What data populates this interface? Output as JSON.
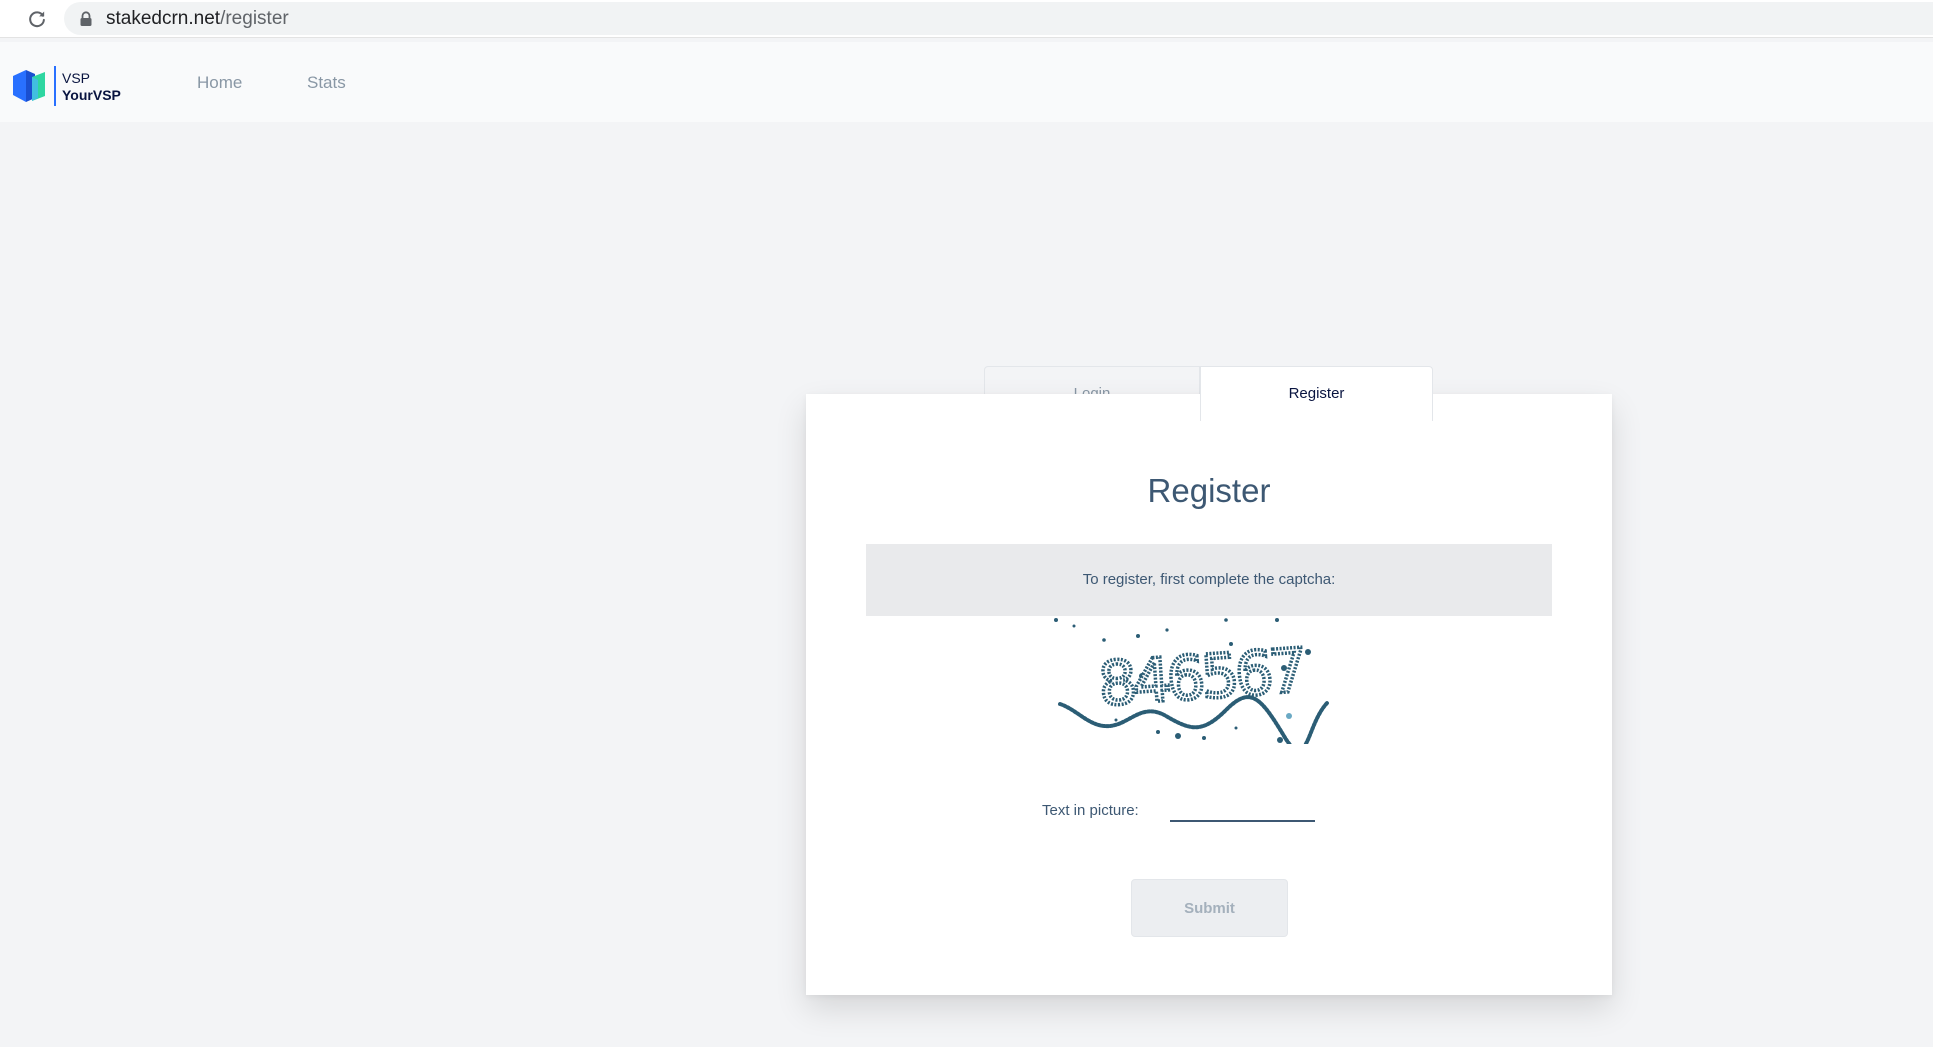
{
  "browser": {
    "url_host": "stakedcrn.net",
    "url_path": "/register"
  },
  "header": {
    "logo_line1": "VSP",
    "logo_line2": "YourVSP",
    "nav": [
      {
        "label": "Home"
      },
      {
        "label": "Stats"
      }
    ]
  },
  "tabs": [
    {
      "label": "Login",
      "active": false
    },
    {
      "label": "Register",
      "active": true
    }
  ],
  "register": {
    "title": "Register",
    "info_text": "To register, first complete the captcha:",
    "captcha_text": "846567",
    "captcha_label": "Text in picture:",
    "captcha_input_value": "",
    "submit_label": "Submit"
  },
  "icons": {
    "reload": "reload-icon",
    "lock": "lock-icon",
    "logo": "vsp-logo-icon"
  },
  "colors": {
    "page_background": "#f3f4f6",
    "header_background": "#f9fafb",
    "brand_blue": "#2970ff",
    "brand_turquoise": "#2ed6a1",
    "text_primary": "#3d5873",
    "text_dark": "#091440",
    "nav_text": "#8997a5",
    "captcha_ink": "#2b5d75"
  }
}
